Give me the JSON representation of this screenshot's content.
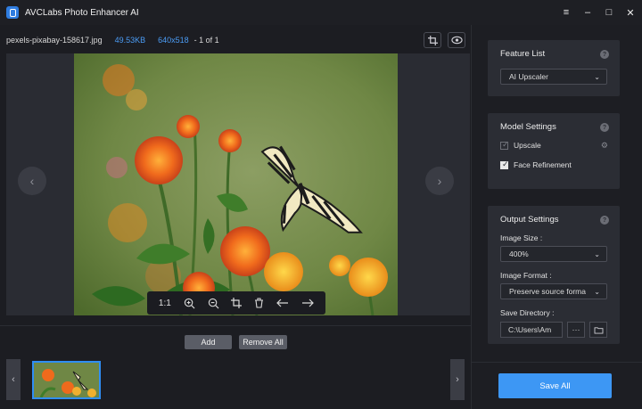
{
  "app": {
    "title": "AVCLabs Photo Enhancer AI"
  },
  "window_controls": {
    "menu": "≡",
    "minimize": "–",
    "maximize": "□",
    "close": "✕"
  },
  "file": {
    "name": "pexels-pixabay-158617.jpg",
    "size": "49.53KB",
    "dimensions": "640x518",
    "index": "- 1 of 1"
  },
  "zoom_bar": {
    "ratio_label": "1:1"
  },
  "actions": {
    "add": "Add",
    "remove_all": "Remove All"
  },
  "feature_list": {
    "title": "Feature List",
    "selected": "AI Upscaler"
  },
  "model_settings": {
    "title": "Model Settings",
    "upscale": {
      "label": "Upscale",
      "checked": true
    },
    "face_refinement": {
      "label": "Face Refinement",
      "checked": true
    }
  },
  "output_settings": {
    "title": "Output Settings",
    "image_size_label": "Image Size :",
    "image_size_value": "400%",
    "image_format_label": "Image Format :",
    "image_format_value": "Preserve source forma",
    "save_directory_label": "Save Directory :",
    "save_directory_value": "C:\\Users\\Am",
    "browse_label": "···"
  },
  "save_all": "Save All",
  "colors": {
    "accent": "#3d97f4",
    "selection": "#2f8ef5",
    "link": "#4b9cf5"
  }
}
